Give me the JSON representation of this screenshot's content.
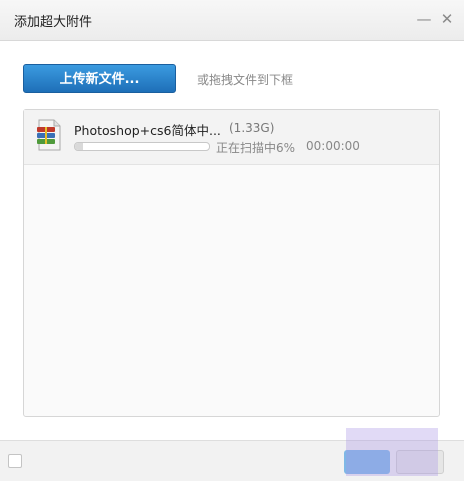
{
  "window": {
    "title": "添加超大附件",
    "minimize_symbol": "—",
    "close_symbol": "✕"
  },
  "toolbar": {
    "upload_label": "上传新文件...",
    "drag_hint": "或拖拽文件到下框"
  },
  "files": [
    {
      "name": "Photoshop+cs6简体中...",
      "size": "(1.33G)",
      "status": "正在扫描中6%",
      "elapsed": "00:00:00",
      "progress_percent": 6,
      "icon": "archive-file-icon"
    }
  ],
  "colors": {
    "accent": "#1e6fb8",
    "progress_fill": "#d9d9d9"
  }
}
